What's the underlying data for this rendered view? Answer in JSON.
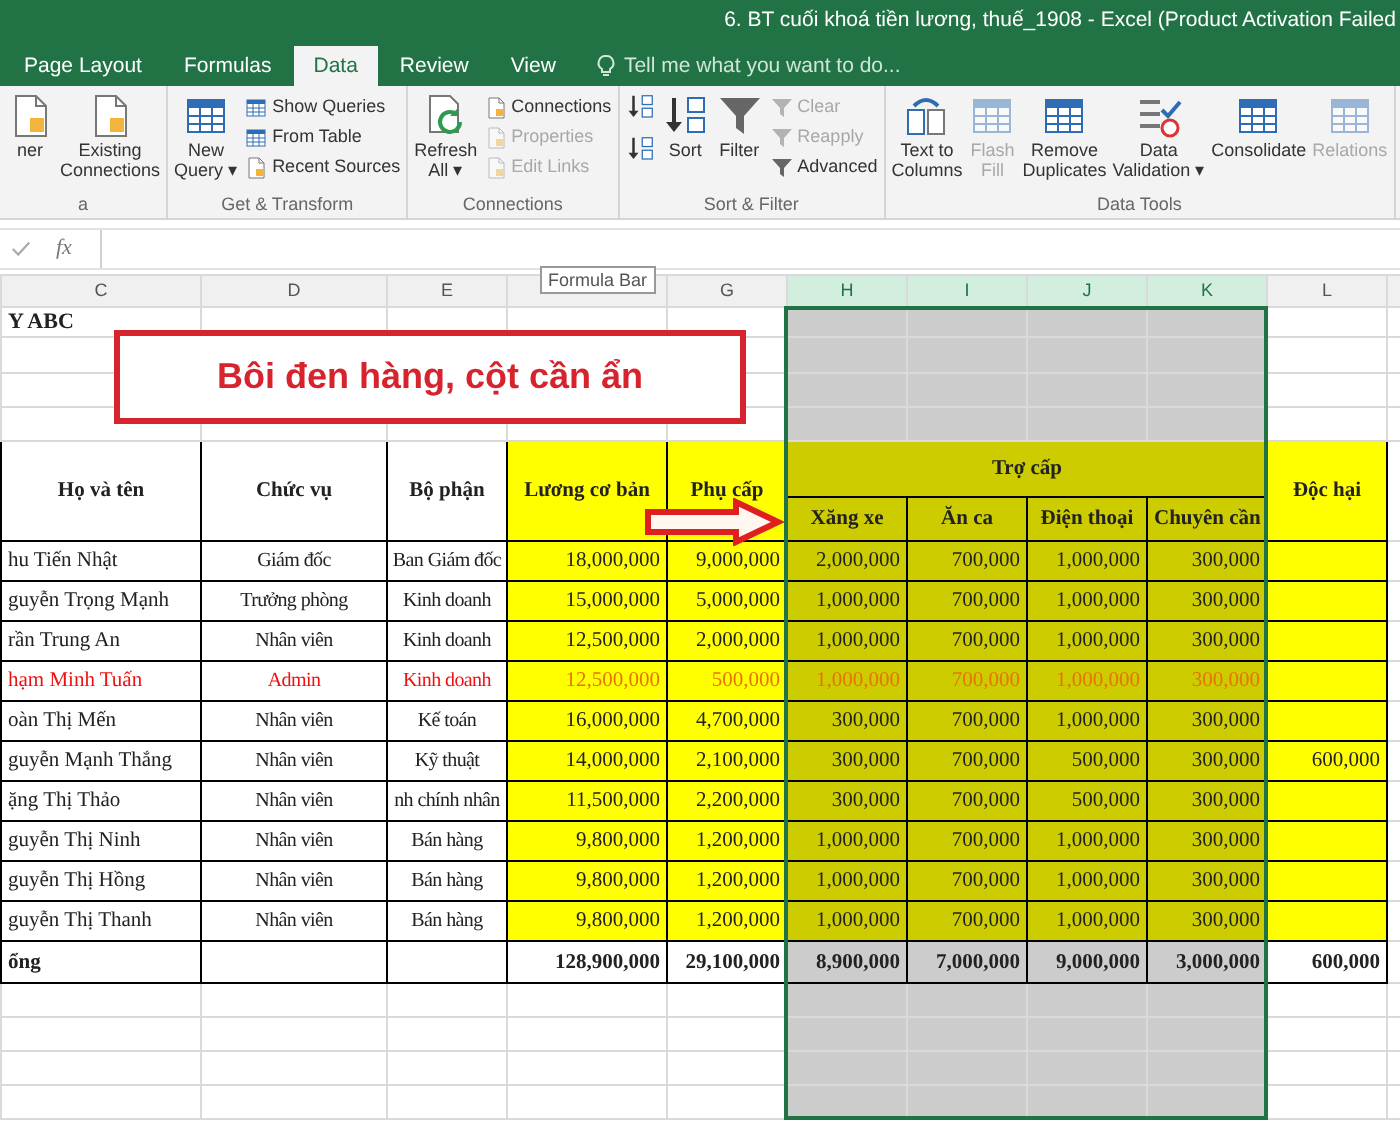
{
  "window": {
    "title": "6. BT cuối khoá tiền lương, thuế_1908 - Excel (Product Activation Failed"
  },
  "tabs": [
    {
      "label": "Page Layout",
      "selected": false
    },
    {
      "label": "Formulas",
      "selected": false
    },
    {
      "label": "Data",
      "selected": true
    },
    {
      "label": "Review",
      "selected": false
    },
    {
      "label": "View",
      "selected": false
    }
  ],
  "tell_me": {
    "placeholder": "Tell me what you want to do..."
  },
  "ribbon": {
    "groups": [
      {
        "label": "a",
        "buttons": [
          {
            "kind": "large",
            "label": "ner",
            "disabled": false
          },
          {
            "kind": "large",
            "label": "Existing\nConnections",
            "disabled": false
          }
        ]
      },
      {
        "label": "Get & Transform",
        "buttons": [
          {
            "kind": "large",
            "label": "New\nQuery ▾",
            "disabled": false
          },
          {
            "kind": "small",
            "label": "Show Queries",
            "disabled": false
          },
          {
            "kind": "small",
            "label": "From Table",
            "disabled": false
          },
          {
            "kind": "small",
            "label": "Recent Sources",
            "disabled": false
          }
        ]
      },
      {
        "label": "Connections",
        "buttons": [
          {
            "kind": "large",
            "label": "Refresh\nAll ▾",
            "disabled": false
          },
          {
            "kind": "small",
            "label": "Connections",
            "disabled": false
          },
          {
            "kind": "small",
            "label": "Properties",
            "disabled": true
          },
          {
            "kind": "small",
            "label": "Edit Links",
            "disabled": true
          }
        ]
      },
      {
        "label": "Sort & Filter",
        "buttons": [
          {
            "kind": "icon",
            "disabled": false
          },
          {
            "kind": "icon",
            "disabled": false
          },
          {
            "kind": "large",
            "label": "Sort",
            "disabled": false
          },
          {
            "kind": "large",
            "label": "Filter",
            "disabled": false
          },
          {
            "kind": "small",
            "label": "Clear",
            "disabled": true
          },
          {
            "kind": "small",
            "label": "Reapply",
            "disabled": true
          },
          {
            "kind": "small",
            "label": "Advanced",
            "disabled": false
          }
        ]
      },
      {
        "label": "Data Tools",
        "buttons": [
          {
            "kind": "large",
            "label": "Text to\nColumns",
            "disabled": false
          },
          {
            "kind": "large",
            "label": "Flash\nFill",
            "disabled": true
          },
          {
            "kind": "large",
            "label": "Remove\nDuplicates",
            "disabled": false
          },
          {
            "kind": "large",
            "label": "Data\nValidation ▾",
            "disabled": false
          },
          {
            "kind": "large",
            "label": "Consolidate",
            "disabled": false
          },
          {
            "kind": "large",
            "label": "Relations",
            "disabled": true
          }
        ]
      }
    ]
  },
  "formula_bar": {
    "label": "fx",
    "tooltip": "Formula Bar"
  },
  "sheet": {
    "columns": [
      {
        "letter": "C",
        "selected": false,
        "color": "#ffffff"
      },
      {
        "letter": "D",
        "selected": false,
        "color": "#ffffff"
      },
      {
        "letter": "E",
        "selected": false,
        "color": "#ffffff"
      },
      {
        "selected": false,
        "color": "#ffff00"
      },
      {
        "letter": "G",
        "selected": false,
        "color": "#ffff00"
      },
      {
        "letter": "H",
        "selected": true,
        "color": "#cccc00"
      },
      {
        "letter": "I",
        "selected": true,
        "color": "#cccc00"
      },
      {
        "letter": "J",
        "selected": true,
        "color": "#cccc00"
      },
      {
        "letter": "K",
        "selected": true,
        "color": "#cccc00"
      },
      {
        "letter": "L",
        "selected": false,
        "color": "#ffff00"
      }
    ],
    "title_cell": "Y ABC",
    "callout": "Bôi đen hàng, cột cần ẩn",
    "headers": [
      {
        "text": "Họ và tên"
      },
      {
        "text": "Chức vụ"
      },
      {
        "text": "Bộ phận"
      },
      {
        "text": "Lương\ncơ bản"
      },
      {
        "text": "Phụ cấp"
      },
      {
        "text": "Trợ cấp",
        "children": [
          {
            "text": "Xăng xe"
          },
          {
            "text": "Ăn ca"
          },
          {
            "text": "Điện thoại"
          },
          {
            "text": "Chuyên cần"
          }
        ]
      },
      {
        "text": "Độc hại"
      }
    ],
    "rows": [
      {
        "highlighted": false,
        "cells": [
          "hu Tiến Nhật",
          "Giám đốc",
          "Ban Giám đốc",
          "18,000,000",
          "9,000,000",
          "2,000,000",
          "700,000",
          "1,000,000",
          "300,000"
        ]
      },
      {
        "highlighted": false,
        "cells": [
          "guyễn Trọng Mạnh",
          "Trưởng phòng",
          "Kinh doanh",
          "15,000,000",
          "5,000,000",
          "1,000,000",
          "700,000",
          "1,000,000",
          "300,000"
        ]
      },
      {
        "highlighted": false,
        "cells": [
          "rần Trung An",
          "Nhân viên",
          "Kinh doanh",
          "12,500,000",
          "2,000,000",
          "1,000,000",
          "700,000",
          "1,000,000",
          "300,000"
        ]
      },
      {
        "highlighted": true,
        "cells": [
          "hạm Minh Tuấn",
          "Admin",
          "Kinh doanh",
          "12,500,000",
          "500,000",
          "1,000,000",
          "700,000",
          "1,000,000",
          "300,000"
        ]
      },
      {
        "highlighted": false,
        "cells": [
          "oàn Thị Mến",
          "Nhân viên",
          "Kế toán",
          "16,000,000",
          "4,700,000",
          "300,000",
          "700,000",
          "1,000,000",
          "300,000"
        ]
      },
      {
        "highlighted": false,
        "cells": [
          "guyễn Mạnh Thắng",
          "Nhân viên",
          "Kỹ thuật",
          "14,000,000",
          "2,100,000",
          "300,000",
          "700,000",
          "500,000",
          "300,000"
        ],
        "doc_hai": "600,000"
      },
      {
        "highlighted": false,
        "cells": [
          "ặng Thị Thảo",
          "Nhân viên",
          "nh chính nhân",
          "11,500,000",
          "2,200,000",
          "300,000",
          "700,000",
          "500,000",
          "300,000"
        ]
      },
      {
        "highlighted": false,
        "cells": [
          "guyễn Thị Ninh",
          "Nhân viên",
          "Bán hàng",
          "9,800,000",
          "1,200,000",
          "1,000,000",
          "700,000",
          "1,000,000",
          "300,000"
        ]
      },
      {
        "highlighted": false,
        "cells": [
          "guyễn Thị Hồng",
          "Nhân viên",
          "Bán hàng",
          "9,800,000",
          "1,200,000",
          "1,000,000",
          "700,000",
          "1,000,000",
          "300,000"
        ]
      },
      {
        "highlighted": false,
        "cells": [
          "guyễn Thị Thanh",
          "Nhân viên",
          "Bán hàng",
          "9,800,000",
          "1,200,000",
          "1,000,000",
          "700,000",
          "1,000,000",
          "300,000"
        ]
      }
    ],
    "total": {
      "label": "ổng",
      "cells": [
        "128,900,000",
        "29,100,000",
        "8,900,000",
        "7,000,000",
        "9,000,000",
        "3,000,000",
        "600,000"
      ]
    }
  }
}
